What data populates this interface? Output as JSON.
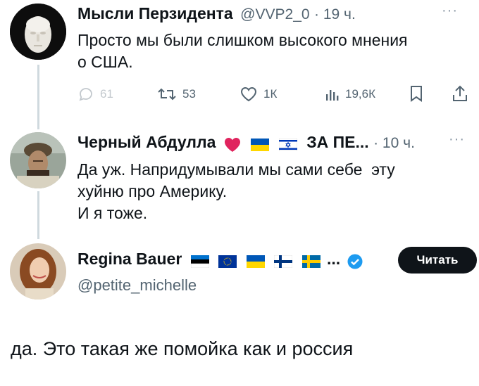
{
  "tweet1": {
    "author": "Мысли Перзидента",
    "handle": "@VVP2_0",
    "time": "· 19 ч.",
    "line1": "Просто мы были слишком высокого мнения",
    "line2": "о США.",
    "actions": {
      "replies": "61",
      "retweets": "53",
      "likes": "1К",
      "views": "19,6К"
    }
  },
  "tweet2": {
    "author": "Черный Абдулла",
    "name_suffix": "ЗА ПЕ...",
    "time": "· 10 ч.",
    "line1": "Да уж. Напридумывали мы сами себе  эту",
    "line2": "хуйню про Америку.",
    "line3": "И я тоже."
  },
  "tweet3": {
    "author": "Regina Bauer",
    "ellipsis": "...",
    "handle": "@petite_michelle",
    "follow_label": "Читать",
    "text": "да. Это такая же помойка как и россия"
  },
  "colors": {
    "accent": "#1d9bf0",
    "text": "#0f1419",
    "muted": "#536471",
    "like_heart": "#e0245e"
  },
  "icons": [
    "more-icon",
    "reply-icon",
    "retweet-icon",
    "like-icon",
    "views-icon",
    "bookmark-icon",
    "share-icon",
    "heart-emoji",
    "verified-badge-icon"
  ]
}
